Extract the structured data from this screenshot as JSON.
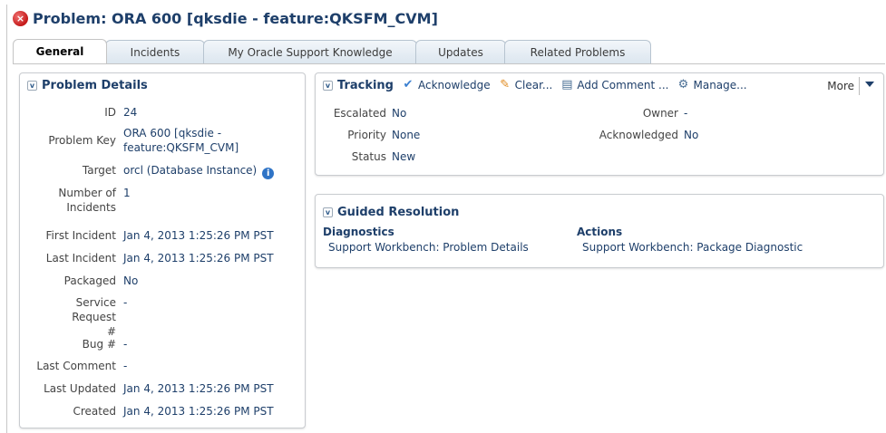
{
  "title": "Problem: ORA 600 [qksdie - feature:QKSFM_CVM]",
  "tabs": [
    "General",
    "Incidents",
    "My Oracle Support Knowledge",
    "Updates",
    "Related Problems"
  ],
  "details": {
    "heading": "Problem Details",
    "rows": [
      {
        "label": "ID",
        "value": "24"
      },
      {
        "label": "Problem Key",
        "value": "ORA 600 [qksdie - feature:QKSFM_CVM]"
      },
      {
        "label": "Target",
        "value": "orcl (Database Instance)"
      },
      {
        "label": "Number of Incidents",
        "value": "1"
      },
      {
        "label": "First Incident",
        "value": "Jan 4, 2013 1:25:26 PM PST"
      },
      {
        "label": "Last Incident",
        "value": "Jan 4, 2013 1:25:26 PM PST"
      },
      {
        "label": "Packaged",
        "value": "No"
      },
      {
        "label": "Service Request #",
        "value": "-"
      },
      {
        "label": "Bug #",
        "value": "-"
      },
      {
        "label": "Last Comment",
        "value": "-"
      },
      {
        "label": "Last Updated",
        "value": "Jan 4, 2013 1:25:26 PM PST"
      },
      {
        "label": "Created",
        "value": "Jan 4, 2013 1:25:26 PM PST"
      }
    ]
  },
  "tracking": {
    "heading": "Tracking",
    "toolbar": [
      "Acknowledge",
      "Clear...",
      "Add Comment ...",
      "Manage..."
    ],
    "more": "More",
    "fields": [
      {
        "label": "Escalated",
        "value": "No"
      },
      {
        "label": "Priority",
        "value": "None"
      },
      {
        "label": "Status",
        "value": "New"
      },
      {
        "label": "Owner",
        "value": "-"
      },
      {
        "label": "Acknowledged",
        "value": "No"
      }
    ]
  },
  "guided": {
    "heading": "Guided Resolution",
    "diagnostics_heading": "Diagnostics",
    "diagnostics_link": "Support Workbench: Problem Details",
    "actions_heading": "Actions",
    "actions_link": "Support Workbench: Package Diagnostic"
  }
}
